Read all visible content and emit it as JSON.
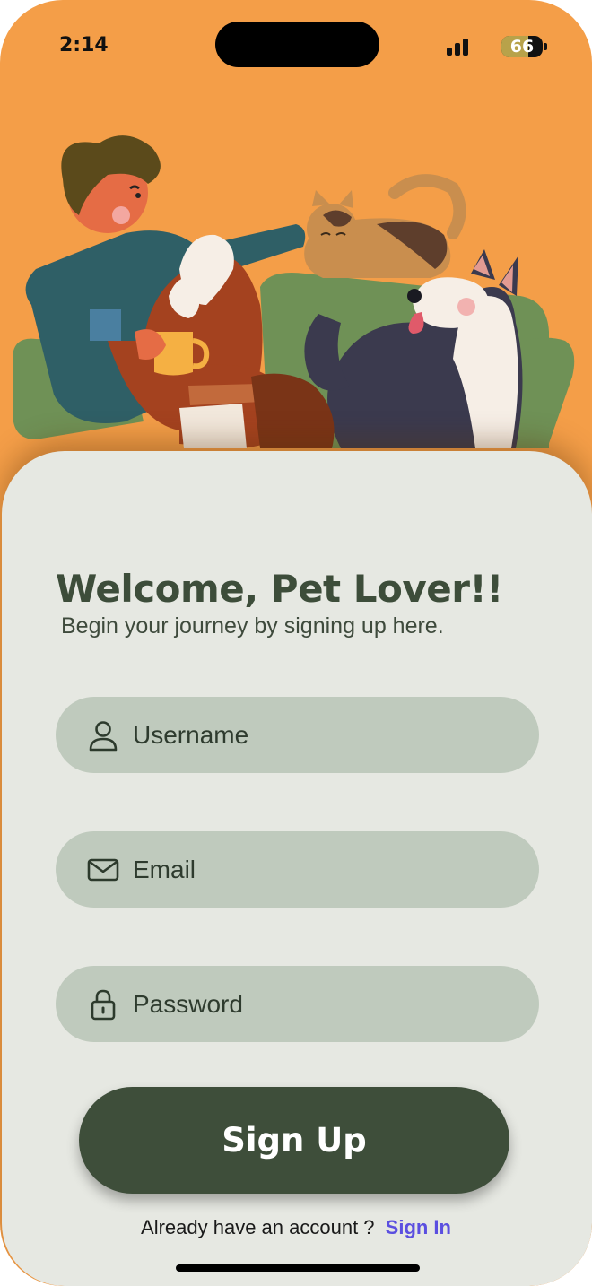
{
  "status_bar": {
    "time": "2:14",
    "battery_level": "66",
    "battery_fraction": 0.66
  },
  "hero": {
    "image": "person-cat-dog-on-couch-illustration"
  },
  "welcome": {
    "title": "Welcome, Pet Lover!!",
    "subtitle": "Begin your journey by signing up here."
  },
  "form": {
    "username": {
      "placeholder": "Username",
      "icon": "user-icon"
    },
    "email": {
      "placeholder": "Email",
      "icon": "mail-icon"
    },
    "password": {
      "placeholder": "Password",
      "icon": "lock-icon"
    },
    "submit_label": "Sign Up"
  },
  "footer": {
    "prompt": "Already have an account ?",
    "link_label": "Sign In"
  },
  "colors": {
    "background": "#F49E48",
    "card": "#E6E8E2",
    "field": "#BFCABD",
    "primary": "#3E4E3A",
    "link": "#5B4FE0"
  }
}
